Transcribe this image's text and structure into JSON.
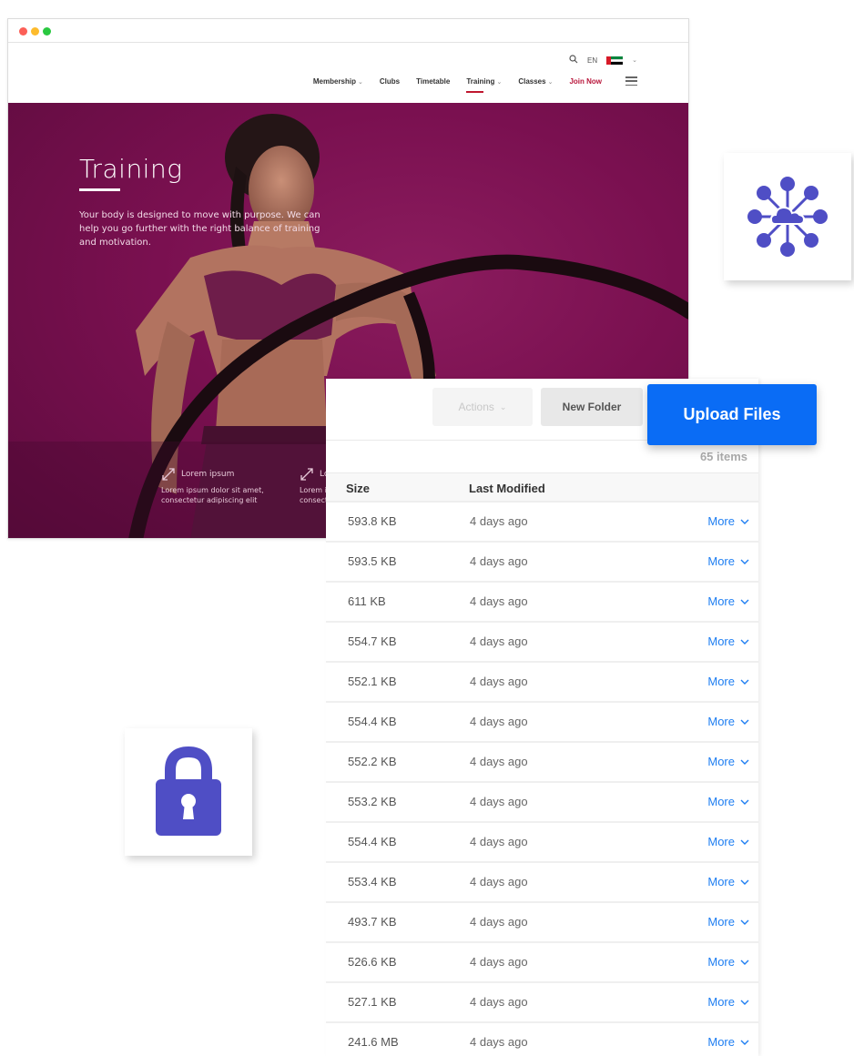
{
  "browser": {
    "window_controls": [
      "close",
      "minimize",
      "maximize"
    ],
    "header": {
      "language": "EN",
      "flag": "uae-flag",
      "nav": [
        {
          "label": "Membership",
          "has_dropdown": true,
          "active": false
        },
        {
          "label": "Clubs",
          "has_dropdown": false,
          "active": false
        },
        {
          "label": "Timetable",
          "has_dropdown": false,
          "active": false
        },
        {
          "label": "Training",
          "has_dropdown": true,
          "active": true
        },
        {
          "label": "Classes",
          "has_dropdown": true,
          "active": false
        }
      ],
      "join_label": "Join Now",
      "accent_color": "#c0172f"
    },
    "hero": {
      "title": "Training",
      "body": "Your body is designed to move with purpose. We can help you go further with the right balance of training and motivation.",
      "background_color": "#7a1050",
      "features": [
        {
          "title": "Lorem ipsum",
          "body": "Lorem ipsum dolor sit amet, consectetur adipiscing elit"
        },
        {
          "title": "Lorem ipsum",
          "body": "Lorem ipsum dolor sit amet, consectetur adipiscing elit"
        }
      ]
    }
  },
  "tiles": {
    "network_icon": "cloud-network-icon",
    "lock_icon": "padlock-icon",
    "icon_color": "#4f4ec5"
  },
  "files": {
    "actions_label": "Actions",
    "new_folder_label": "New Folder",
    "upload_label": "Upload Files",
    "upload_color": "#0a6cf5",
    "item_count": "65 items",
    "columns": {
      "size": "Size",
      "modified": "Last Modified"
    },
    "more_label": "More",
    "rows": [
      {
        "size": "593.8 KB",
        "modified": "4 days ago"
      },
      {
        "size": "593.5 KB",
        "modified": "4 days ago"
      },
      {
        "size": "611 KB",
        "modified": "4 days ago"
      },
      {
        "size": "554.7 KB",
        "modified": "4 days ago"
      },
      {
        "size": "552.1 KB",
        "modified": "4 days ago"
      },
      {
        "size": "554.4 KB",
        "modified": "4 days ago"
      },
      {
        "size": "552.2 KB",
        "modified": "4 days ago"
      },
      {
        "size": "553.2 KB",
        "modified": "4 days ago"
      },
      {
        "size": "554.4 KB",
        "modified": "4 days ago"
      },
      {
        "size": "553.4 KB",
        "modified": "4 days ago"
      },
      {
        "size": "493.7 KB",
        "modified": "4 days ago"
      },
      {
        "size": "526.6 KB",
        "modified": "4 days ago"
      },
      {
        "size": "527.1 KB",
        "modified": "4 days ago"
      },
      {
        "size": "241.6 MB",
        "modified": "4 days ago"
      }
    ]
  }
}
